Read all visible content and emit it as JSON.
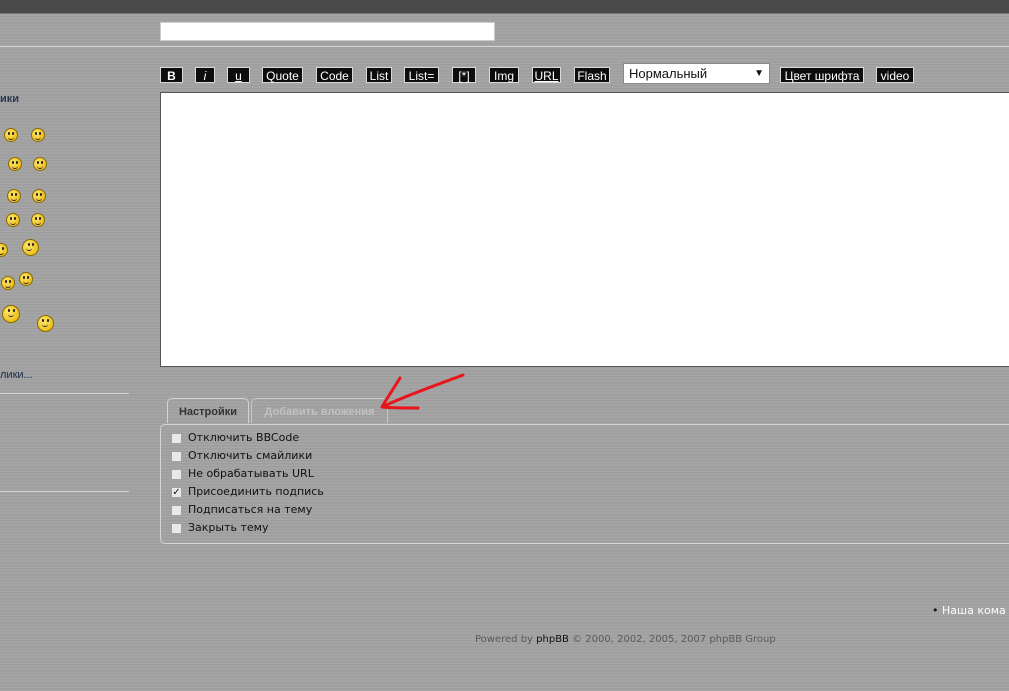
{
  "subject": {
    "value": ""
  },
  "toolbar": {
    "buttons": [
      {
        "label": "B"
      },
      {
        "label": "i"
      },
      {
        "label": "u"
      },
      {
        "label": "Quote"
      },
      {
        "label": "Code"
      },
      {
        "label": "List"
      },
      {
        "label": "List="
      },
      {
        "label": "[*]"
      },
      {
        "label": "Img"
      },
      {
        "label": "URL"
      },
      {
        "label": "Flash"
      }
    ],
    "font_size_select": "Нормальный",
    "color_button": "Цвет шрифта",
    "video_button": "video"
  },
  "message": {
    "value": ""
  },
  "smilies": {
    "title": "ики",
    "more_link": "лики..."
  },
  "tabs": [
    {
      "label": "Настройки",
      "active": true
    },
    {
      "label": "Добавить вложения",
      "active": false
    }
  ],
  "options": [
    {
      "label": "Отключить BBCode",
      "checked": false
    },
    {
      "label": "Отключить смайлики",
      "checked": false
    },
    {
      "label": "Не обрабатывать URL",
      "checked": false
    },
    {
      "label": "Присоединить подпись",
      "checked": true
    },
    {
      "label": "Подписаться на тему",
      "checked": false
    },
    {
      "label": "Закрыть тему",
      "checked": false
    }
  ],
  "team_link": "Наша кома",
  "footer": {
    "prefix": "Powered by",
    "brand": "phpBB",
    "suffix": "© 2000, 2002, 2005, 2007 phpBB Group"
  },
  "colors": {
    "background": "#a1a1a1",
    "annotation_arrow": "#e8151b",
    "button_bg": "#0d0d0d"
  }
}
